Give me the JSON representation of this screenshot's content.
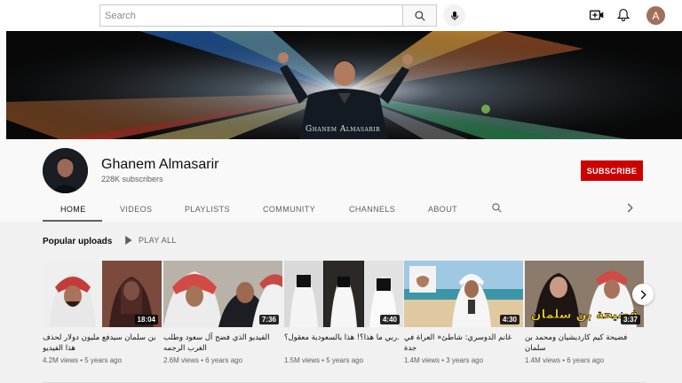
{
  "search": {
    "placeholder": "Search"
  },
  "user": {
    "avatar_letter": "A"
  },
  "banner": {
    "caption": "Ghanem Almasarir"
  },
  "channel": {
    "name": "Ghanem Almasarir",
    "subscribers": "228K subscribers",
    "subscribe_label": "SUBSCRIBE"
  },
  "tabs": [
    {
      "label": "HOME"
    },
    {
      "label": "VIDEOS"
    },
    {
      "label": "PLAYLISTS"
    },
    {
      "label": "COMMUNITY"
    },
    {
      "label": "CHANNELS"
    },
    {
      "label": "ABOUT"
    }
  ],
  "section": {
    "title": "Popular uploads",
    "play_all": "PLAY ALL"
  },
  "videos": [
    {
      "title": "بن سلمان سيدفع مليون دولار لحذف هذا الفيديو",
      "duration": "18:04",
      "meta": "4.2M views • 5 years ago"
    },
    {
      "title": "الفيديو الذي فضح آل سعود وطلب الغرب الرجمه",
      "duration": "7:36",
      "meta": "2.6M views • 6 years ago"
    },
    {
      "title": ".ربي ما هذا؟! هذا بالسعودية معقول؟",
      "duration": "4:40",
      "meta": "1.5M views • 5 years ago"
    },
    {
      "title": "غانم الدوسري: شاطئ« العراة في جدة",
      "duration": "4:30",
      "meta": "1.4M views • 3 years ago"
    },
    {
      "title": "فضيحة كيم كارديشيان ومحمد بن سلمان",
      "duration": "3:37",
      "meta": "1.4M views • 6 years ago"
    }
  ],
  "thumb_overlay_text": "فضيحة بن سلمان",
  "colors": {
    "subscribe": "#cc0000",
    "accent_text": "#0f0f0f",
    "meta": "#606060"
  }
}
